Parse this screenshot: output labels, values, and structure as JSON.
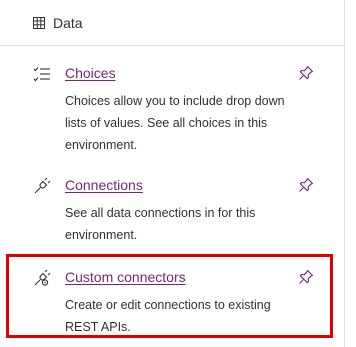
{
  "header": {
    "title": "Data",
    "icon": "table-icon"
  },
  "items": [
    {
      "title": "Choices",
      "description": "Choices allow you to include drop down lists of values. See all choices in this environment.",
      "icon": "list-icon",
      "pin_icon": "pin-icon"
    },
    {
      "title": "Connections",
      "description": "See all data connections in for this environment.",
      "icon": "plug-icon",
      "pin_icon": "pin-icon"
    },
    {
      "title": "Custom connectors",
      "description": "Create or edit connections to existing REST APIs.",
      "icon": "plug-gear-icon",
      "pin_icon": "pin-icon"
    }
  ],
  "colors": {
    "link": "#742774",
    "highlight": "#e00000",
    "text": "#323130",
    "divider": "#e1dfdd"
  }
}
